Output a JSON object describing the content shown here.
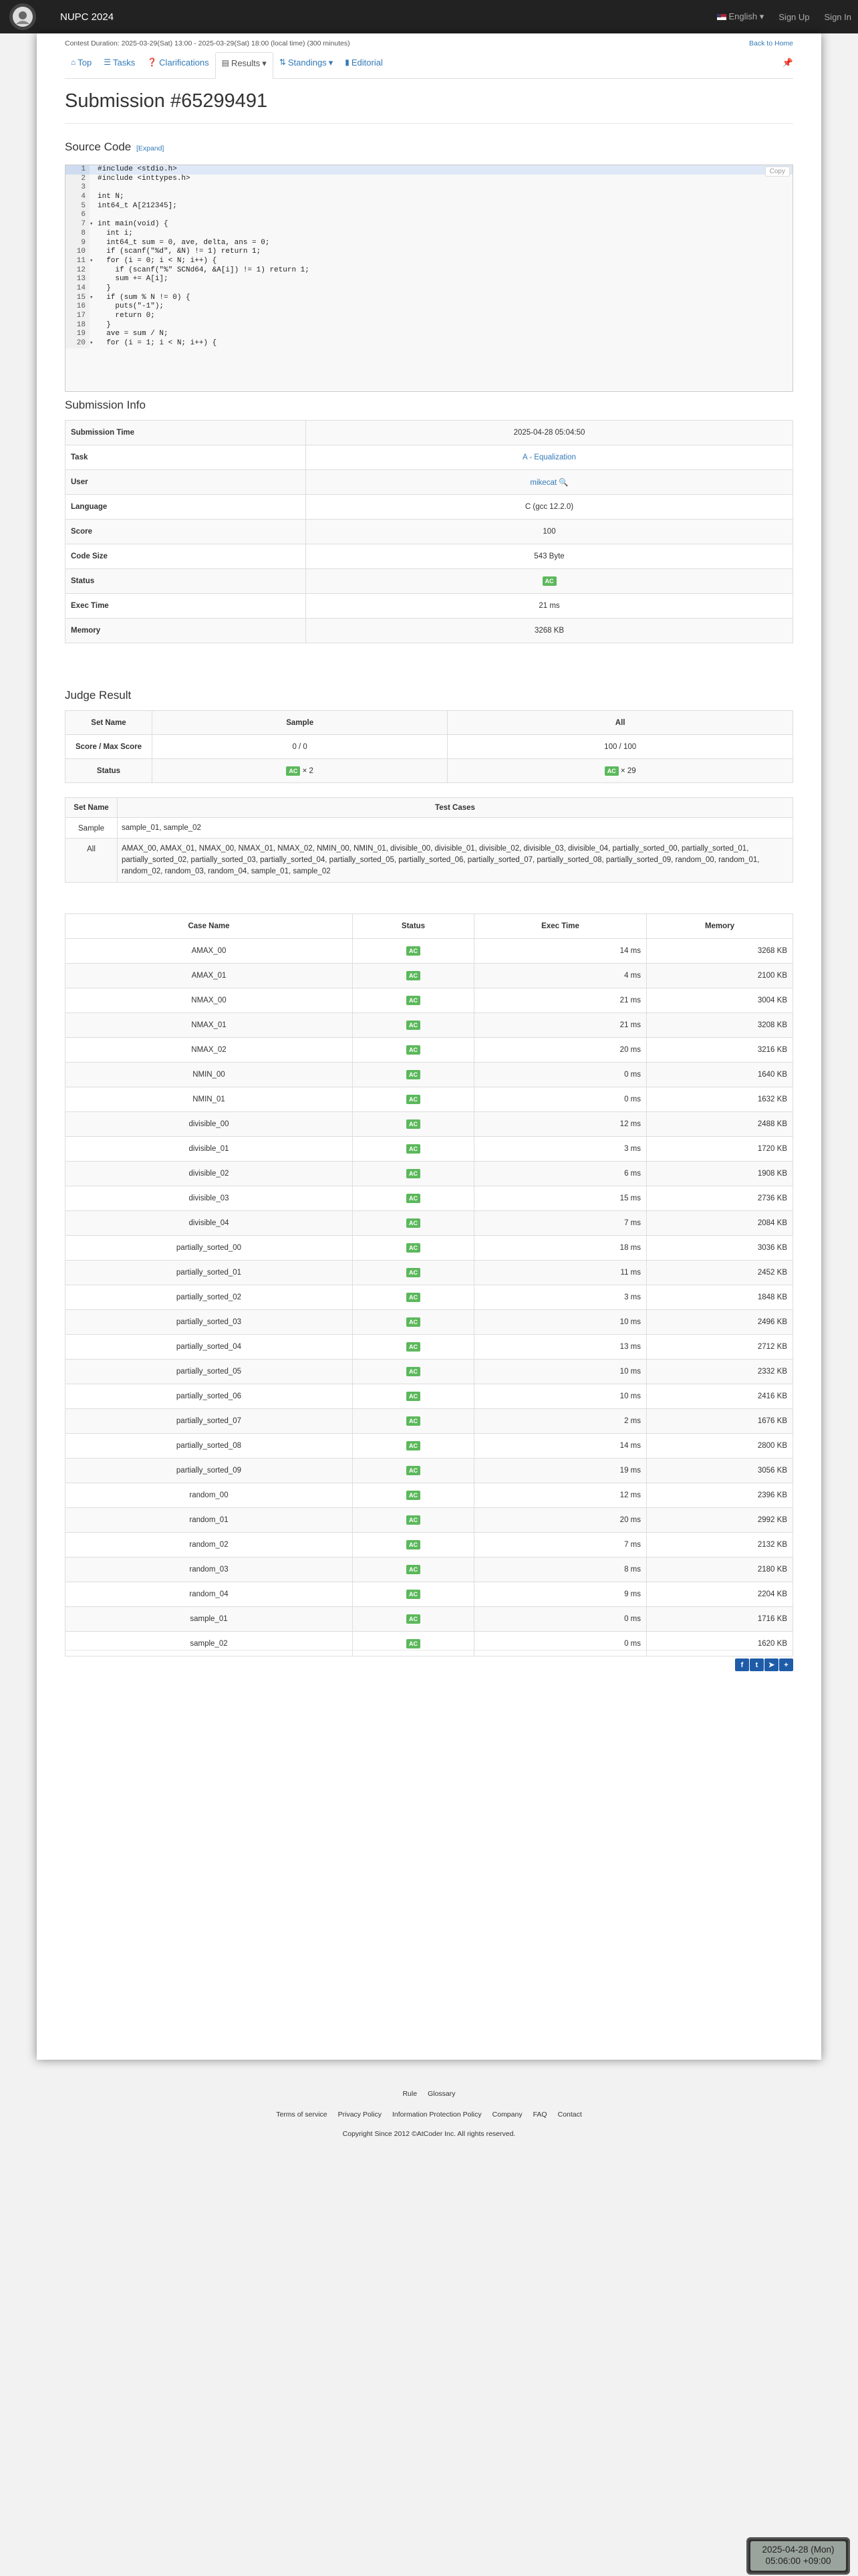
{
  "navbar": {
    "brand": "NUPC 2024",
    "language": "English",
    "sign_up": "Sign Up",
    "sign_in": "Sign In"
  },
  "contest_duration": "Contest Duration: 2025-03-29(Sat) 13:00 - 2025-03-29(Sat) 18:00 (local time) (300 minutes)",
  "back_home": "Back to Home",
  "tabs": [
    {
      "icon": "home-icon",
      "label": "Top"
    },
    {
      "icon": "tasks-icon",
      "label": "Tasks"
    },
    {
      "icon": "question-icon",
      "label": "Clarifications"
    },
    {
      "icon": "list-icon",
      "label": "Results"
    },
    {
      "icon": "sort-icon",
      "label": "Standings"
    },
    {
      "icon": "book-icon",
      "label": "Editorial"
    }
  ],
  "page_title": "Submission #65299491",
  "source_code": {
    "heading": "Source Code",
    "expand": "[Expand]",
    "copy": "Copy",
    "lines": [
      "#include <stdio.h>",
      "#include <inttypes.h>",
      "",
      "int N;",
      "int64_t A[212345];",
      "",
      "int main(void) {",
      "  int i;",
      "  int64_t sum = 0, ave, delta, ans = 0;",
      "  if (scanf(\"%d\", &N) != 1) return 1;",
      "  for (i = 0; i < N; i++) {",
      "    if (scanf(\"%\" SCNd64, &A[i]) != 1) return 1;",
      "    sum += A[i];",
      "  }",
      "  if (sum % N != 0) {",
      "    puts(\"-1\");",
      "    return 0;",
      "  }",
      "  ave = sum / N;",
      "  for (i = 1; i < N; i++) {"
    ]
  },
  "submission_info": {
    "heading": "Submission Info",
    "rows": [
      {
        "label": "Submission Time",
        "value": "2025-04-28 05:04:50"
      },
      {
        "label": "Task",
        "value": "A - Equalization"
      },
      {
        "label": "User",
        "value": "mikecat"
      },
      {
        "label": "Language",
        "value": "C (gcc 12.2.0)"
      },
      {
        "label": "Score",
        "value": "100"
      },
      {
        "label": "Code Size",
        "value": "543 Byte"
      },
      {
        "label": "Status",
        "value": "AC"
      },
      {
        "label": "Exec Time",
        "value": "21 ms"
      },
      {
        "label": "Memory",
        "value": "3268 KB"
      }
    ]
  },
  "judge_result": {
    "heading": "Judge Result",
    "headers": [
      "Set Name",
      "Sample",
      "All"
    ],
    "score_label": "Score / Max Score",
    "sample_score": "0 / 0",
    "all_score": "100 / 100",
    "status_label": "Status",
    "sample_status": "AC",
    "sample_count": "× 2",
    "all_status": "AC",
    "all_count": "× 29"
  },
  "test_sets": {
    "headers": [
      "Set Name",
      "Test Cases"
    ],
    "rows": [
      {
        "name": "Sample",
        "cases": "sample_01, sample_02"
      },
      {
        "name": "All",
        "cases": "AMAX_00, AMAX_01, NMAX_00, NMAX_01, NMAX_02, NMIN_00, NMIN_01, divisible_00, divisible_01, divisible_02, divisible_03, divisible_04, partially_sorted_00, partially_sorted_01, partially_sorted_02, partially_sorted_03, partially_sorted_04, partially_sorted_05, partially_sorted_06, partially_sorted_07, partially_sorted_08, partially_sorted_09, random_00, random_01, random_02, random_03, random_04, sample_01, sample_02"
      }
    ]
  },
  "cases": {
    "headers": [
      "Case Name",
      "Status",
      "Exec Time",
      "Memory"
    ],
    "rows": [
      {
        "name": "AMAX_00",
        "status": "AC",
        "time": "14 ms",
        "memory": "3268 KB"
      },
      {
        "name": "AMAX_01",
        "status": "AC",
        "time": "4 ms",
        "memory": "2100 KB"
      },
      {
        "name": "NMAX_00",
        "status": "AC",
        "time": "21 ms",
        "memory": "3004 KB"
      },
      {
        "name": "NMAX_01",
        "status": "AC",
        "time": "21 ms",
        "memory": "3208 KB"
      },
      {
        "name": "NMAX_02",
        "status": "AC",
        "time": "20 ms",
        "memory": "3216 KB"
      },
      {
        "name": "NMIN_00",
        "status": "AC",
        "time": "0 ms",
        "memory": "1640 KB"
      },
      {
        "name": "NMIN_01",
        "status": "AC",
        "time": "0 ms",
        "memory": "1632 KB"
      },
      {
        "name": "divisible_00",
        "status": "AC",
        "time": "12 ms",
        "memory": "2488 KB"
      },
      {
        "name": "divisible_01",
        "status": "AC",
        "time": "3 ms",
        "memory": "1720 KB"
      },
      {
        "name": "divisible_02",
        "status": "AC",
        "time": "6 ms",
        "memory": "1908 KB"
      },
      {
        "name": "divisible_03",
        "status": "AC",
        "time": "15 ms",
        "memory": "2736 KB"
      },
      {
        "name": "divisible_04",
        "status": "AC",
        "time": "7 ms",
        "memory": "2084 KB"
      },
      {
        "name": "partially_sorted_00",
        "status": "AC",
        "time": "18 ms",
        "memory": "3036 KB"
      },
      {
        "name": "partially_sorted_01",
        "status": "AC",
        "time": "11 ms",
        "memory": "2452 KB"
      },
      {
        "name": "partially_sorted_02",
        "status": "AC",
        "time": "3 ms",
        "memory": "1848 KB"
      },
      {
        "name": "partially_sorted_03",
        "status": "AC",
        "time": "10 ms",
        "memory": "2496 KB"
      },
      {
        "name": "partially_sorted_04",
        "status": "AC",
        "time": "13 ms",
        "memory": "2712 KB"
      },
      {
        "name": "partially_sorted_05",
        "status": "AC",
        "time": "10 ms",
        "memory": "2332 KB"
      },
      {
        "name": "partially_sorted_06",
        "status": "AC",
        "time": "10 ms",
        "memory": "2416 KB"
      },
      {
        "name": "partially_sorted_07",
        "status": "AC",
        "time": "2 ms",
        "memory": "1676 KB"
      },
      {
        "name": "partially_sorted_08",
        "status": "AC",
        "time": "14 ms",
        "memory": "2800 KB"
      },
      {
        "name": "partially_sorted_09",
        "status": "AC",
        "time": "19 ms",
        "memory": "3056 KB"
      },
      {
        "name": "random_00",
        "status": "AC",
        "time": "12 ms",
        "memory": "2396 KB"
      },
      {
        "name": "random_01",
        "status": "AC",
        "time": "20 ms",
        "memory": "2992 KB"
      },
      {
        "name": "random_02",
        "status": "AC",
        "time": "7 ms",
        "memory": "2132 KB"
      },
      {
        "name": "random_03",
        "status": "AC",
        "time": "8 ms",
        "memory": "2180 KB"
      },
      {
        "name": "random_04",
        "status": "AC",
        "time": "9 ms",
        "memory": "2204 KB"
      },
      {
        "name": "sample_01",
        "status": "AC",
        "time": "0 ms",
        "memory": "1716 KB"
      },
      {
        "name": "sample_02",
        "status": "AC",
        "time": "0 ms",
        "memory": "1620 KB"
      }
    ]
  },
  "footer": {
    "links_top": [
      "Rule",
      "Glossary"
    ],
    "links_bottom": [
      "Terms of service",
      "Privacy Policy",
      "Information Protection Policy",
      "Company",
      "FAQ",
      "Contact"
    ],
    "copyright": "Copyright Since 2012 ©AtCoder Inc. All rights reserved."
  },
  "clock": {
    "date": "2025-04-28 (Mon)",
    "time": "05:06:00 +09:00"
  },
  "colors": {
    "navbar": "#222222",
    "link": "#337ab7",
    "ac_badge": "#5cb85c"
  }
}
